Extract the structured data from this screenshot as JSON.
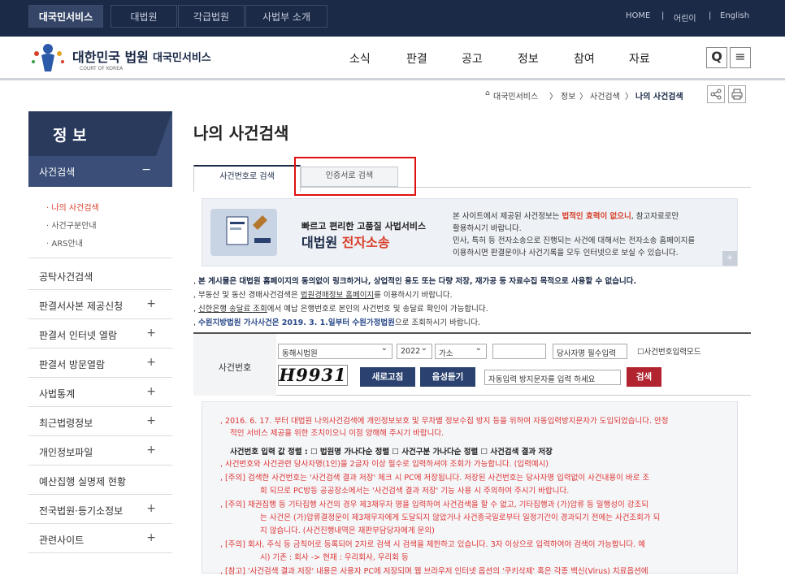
{
  "topbar": {
    "tabs": [
      "대국민서비스",
      "대법원",
      "각급법원",
      "사법부 소개"
    ],
    "links": [
      "HOME",
      "|",
      "어린이",
      "|",
      "English"
    ]
  },
  "header": {
    "brand": "대한민국 법원",
    "brand_sub": "대국민서비스",
    "brand_en": "COURT OF KOREA",
    "nav": [
      "소식",
      "판결",
      "공고",
      "정보",
      "참여",
      "자료"
    ],
    "search_icon": "Q",
    "menu_icon": "≡"
  },
  "breadcrumb": {
    "home_icon": "⌂",
    "items": [
      "대국민서비스",
      "〉",
      "정보",
      "〉",
      "사건검색",
      "〉",
      "나의 사건검색"
    ]
  },
  "sidebar": {
    "title": "정 보",
    "active": {
      "label": "사건검색",
      "toggle": "−"
    },
    "sub": [
      "· 나의 사건검색",
      "· 사건구분안내",
      "· ARS안내"
    ],
    "items": [
      {
        "label": "공탁사건검색",
        "toggle": ""
      },
      {
        "label": "판결서사본 제공신청",
        "toggle": "+"
      },
      {
        "label": "판결서 인터넷 열람",
        "toggle": "+"
      },
      {
        "label": "판결서 방문열람",
        "toggle": "+"
      },
      {
        "label": "사법통계",
        "toggle": "+"
      },
      {
        "label": "최근법령정보",
        "toggle": "+"
      },
      {
        "label": "개인정보파일",
        "toggle": "+"
      },
      {
        "label": "예산집행 실명제 현황",
        "toggle": ""
      },
      {
        "label": "전국법원·등기소정보",
        "toggle": "+"
      },
      {
        "label": "관련사이트",
        "toggle": "+"
      }
    ]
  },
  "main": {
    "title": "나의 사건검색",
    "tabs": [
      "사건번호로 검색",
      "인증서로 검색"
    ],
    "banner": {
      "line1": "빠르고 편리한 고품질 사법서비스",
      "line2a": "대법원 ",
      "line2b": "전자소송",
      "r1a": "본 사이트에서 제공된 사건정보는 ",
      "r1b": "법적인 효력이 없으니",
      "r1c": ", 참고자료로만",
      "r2": "활용하시기 바랍니다.",
      "r3": "민사, 특허 등 전자소송으로 진행되는 사건에 대해서는 전자소송 홈페이지를",
      "r4": "이용하시면 판결문이나 사건기록을 모두 인터넷으로 보실 수 있습니다.",
      "plus": "+"
    },
    "notices": [
      {
        "a": ", ",
        "b": "본 게시물은 대법원 홈페이지의 동의없이 링크하거나, 상업적인 용도 또는 다량 저장, 재가공 등 자료수집 목적으로 사용할 수 없습니다.",
        "c": ""
      },
      {
        "a": ", 부동산 및 동산 경매사건검색은 ",
        "b": "법원경매정보 홈페이지",
        "c": "를 이용하시기 바랍니다."
      },
      {
        "a": ", ",
        "b": "신한은행 송달료 조회",
        "c": "에서 예납 은행번호로 본인의 사건번호 및 송달료 확인이 가능합니다."
      },
      {
        "a": ", ",
        "b": "수원지방법원 가사사건은 2019. 3. 1.일부터 수원가정법원",
        "c": "으로 조회하시기 바랍니다."
      }
    ],
    "search": {
      "label": "사건번호",
      "court": "동해시법원",
      "year": "2022",
      "type": "가소",
      "number": "",
      "party_placeholder": "당사자명 필수입력",
      "mode_label": "사건번호입력모드",
      "captcha": "H9931",
      "refresh": "새로고침",
      "audio": "음성듣기",
      "captcha_placeholder": "자동입력 방지문자를 입력 하세요",
      "submit": "검색"
    },
    "info": [
      ", 2016. 6. 17. 부터 대법원 나의사건검색에 개인정보보호 및 무차별 정보수집 방지 등을 위하여 자동입력방지문자가 도입되었습니다. 안정",
      "적인 서비스 제공을 위한 조치이오니 이점 양해해 주시기 바랍니다.",
      "사건번호 입력 값 정렬 :  ☐ 법원명 가나다순 정렬   ☐ 사건구분 가나다순 정렬   ☐ 사건검색 결과 저장",
      ", 사건번호와 사건관련 당사자명(1인)을 2글자 이상 필수로 입력하셔야 조회가 가능합니다. (입력예시)",
      ", [주의]   검색한 사건번호는 '사건검색 결과 저장' 체크 시 PC에 저장됩니다. 저장된 사건번호는 당사자명 입력없이 사건내용이 바로 조",
      "회 되므로 PC방등 공공장소에서는 '사건검색 결과 저장' 기능 사용 시 주의하여 주시기 바랍니다.",
      ", [주의]   채권집행 등 기타집행 사건의 경우 제3채무자 명을 입력하여 사건검색을 할 수 없고, 기타집행과 (가)압류 등 밀행성이 강조되",
      "는 사건은 (가)압류결정문이 제3채무자에게 도달되지 않았거나 사건종국일로부터 일정기간이 경과되기 전에는 사건조회가 되",
      "지 않습니다. (사건진행내역은 재판부담당자에게 문의)",
      ", [주의]   회사, 주식 등 금칙어로 등록되어 2자로 검색 시 검색을 제한하고 있습니다. 3자 이상으로 입력하여야 검색이 가능합니다. 예",
      "시) 기존 : 회사 -> 현재 : 우리회사, 우리회 등",
      ", [참고]   '사건검색 결과 저장' 내용은 사용자 PC에 저장되며 웹 브라우저 인터넷 옵션의 '쿠키삭제' 혹은 각종 백신(Virus) 치료옵션에"
    ]
  }
}
